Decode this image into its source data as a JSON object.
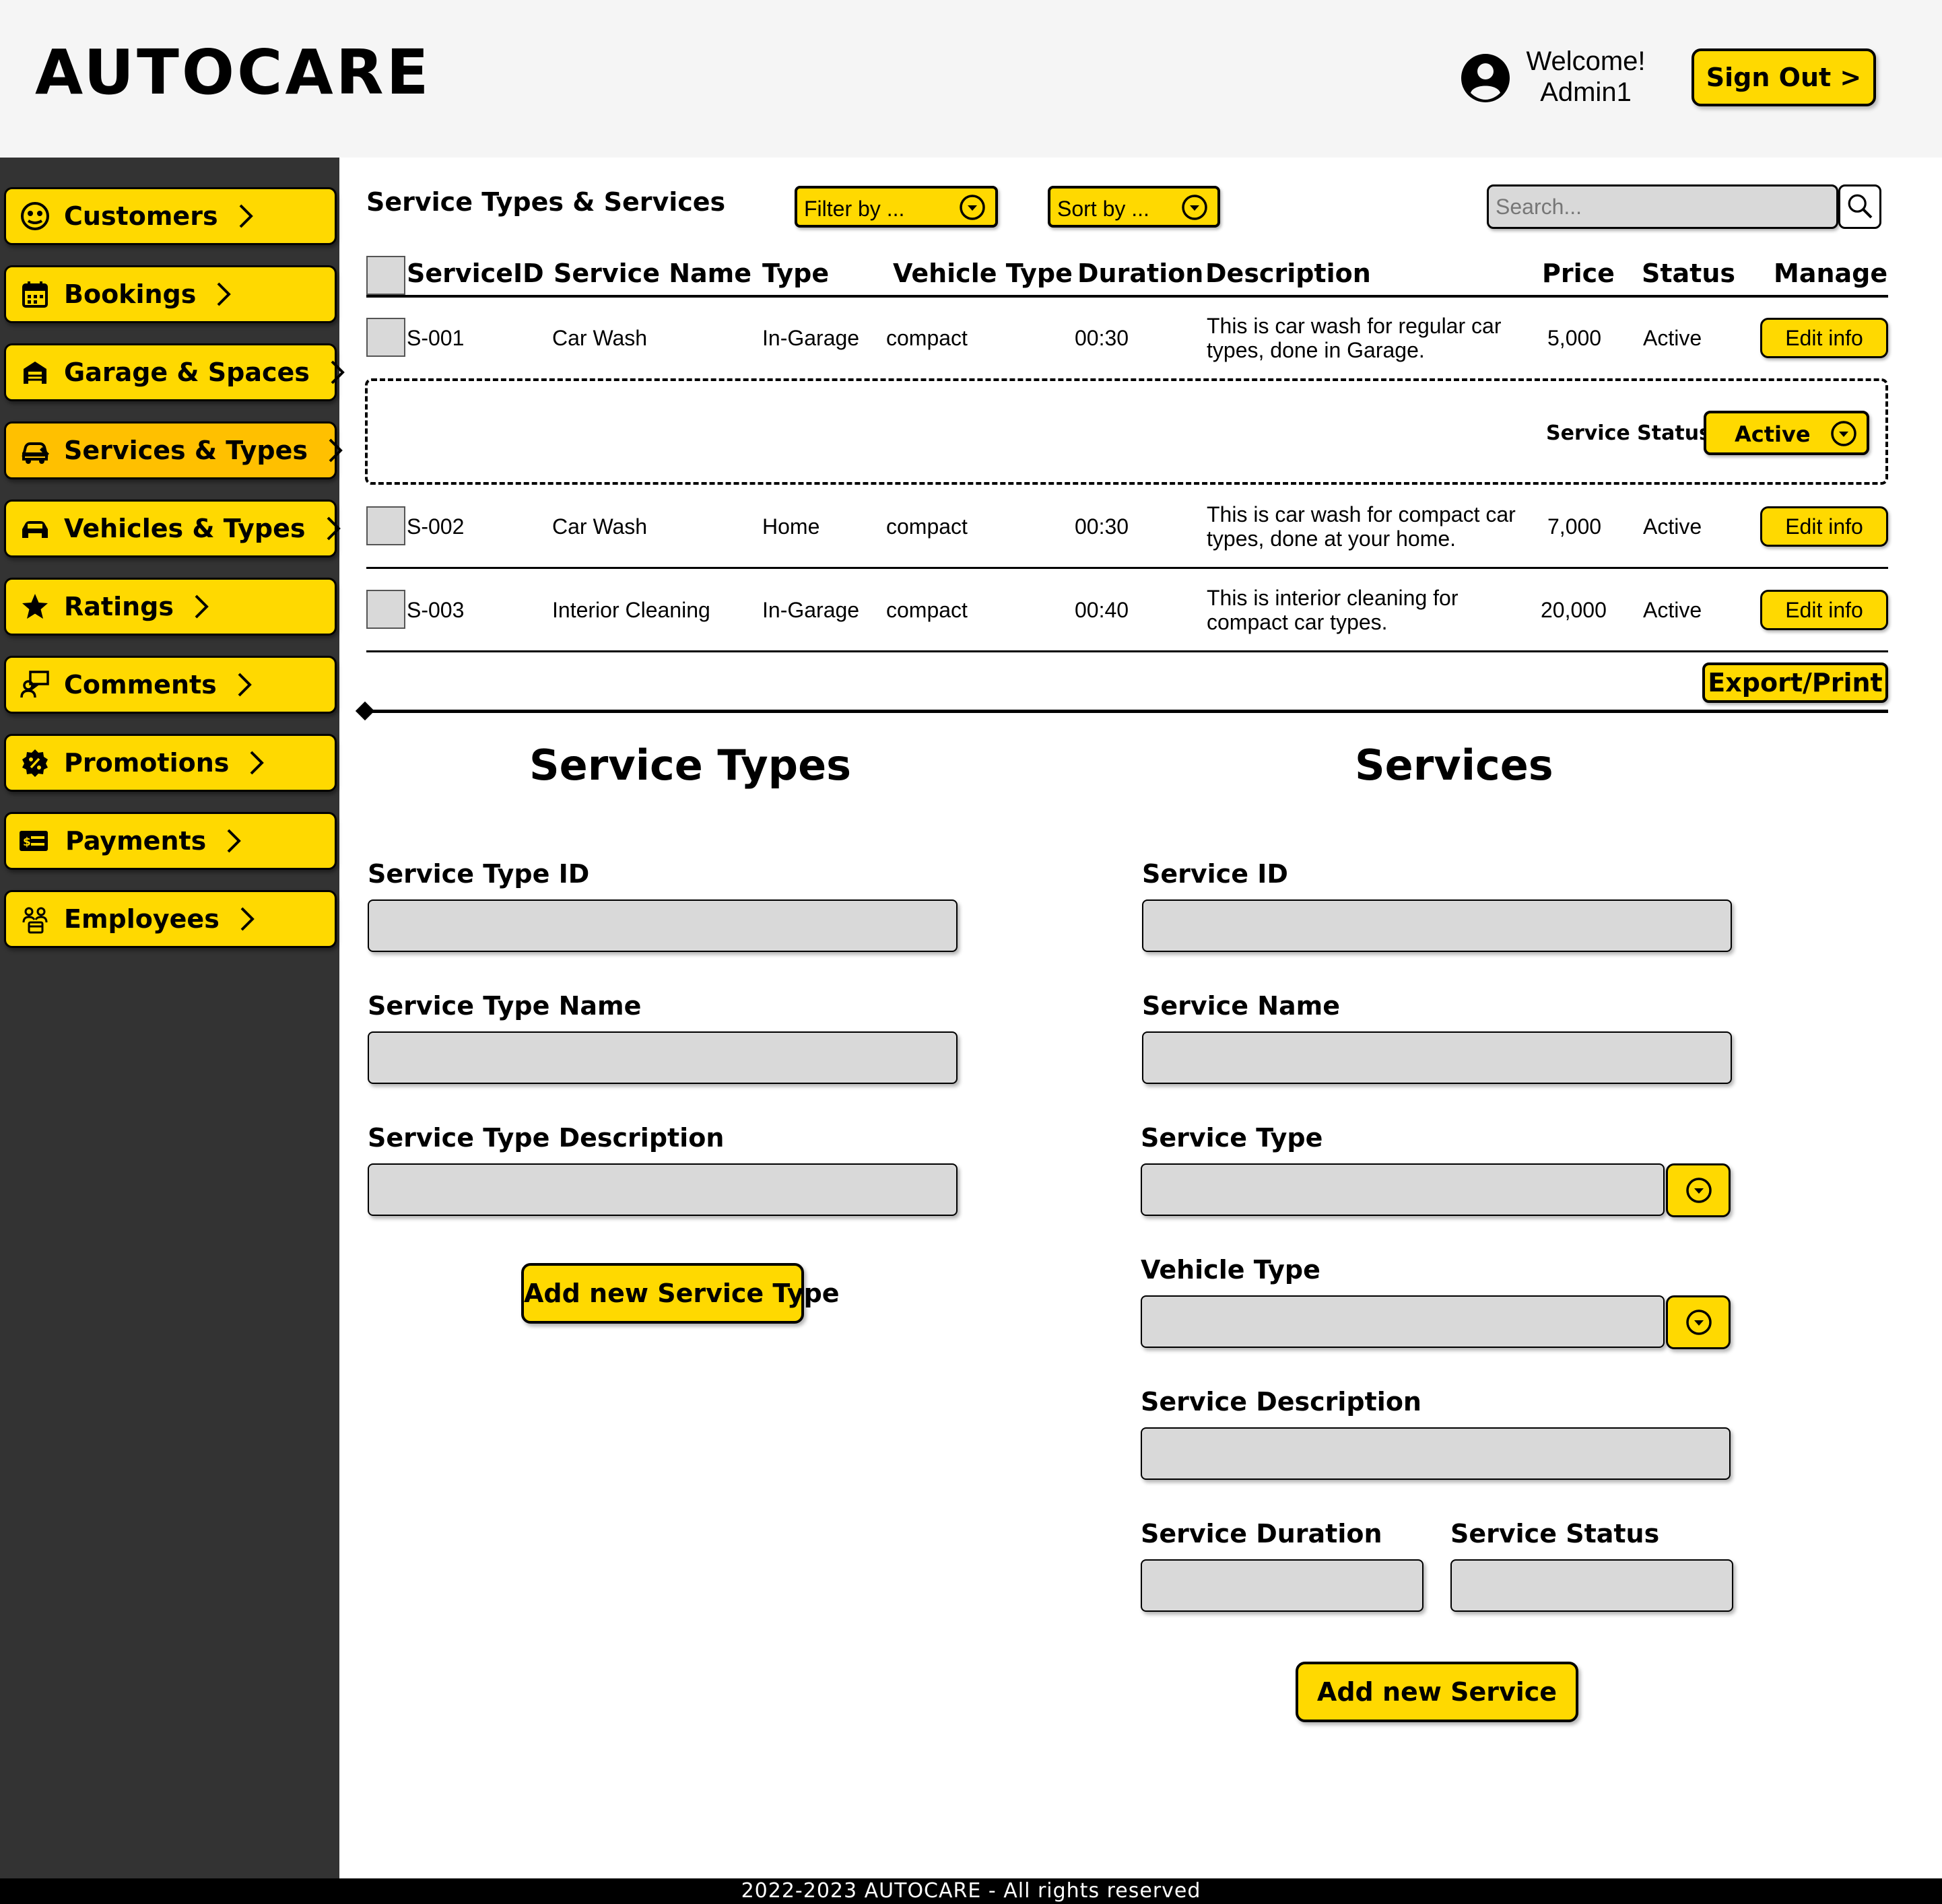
{
  "app": {
    "logo": "AUTOCARE"
  },
  "header": {
    "welcome_line1": "Welcome!",
    "welcome_line2": "Admin1",
    "sign_out_label": "Sign Out >"
  },
  "sidebar": {
    "items": [
      {
        "label": "Customers",
        "icon": "customers-icon"
      },
      {
        "label": "Bookings",
        "icon": "calendar-icon"
      },
      {
        "label": "Garage & Spaces",
        "icon": "garage-icon"
      },
      {
        "label": "Services & Types",
        "icon": "car-service-icon",
        "active": true
      },
      {
        "label": "Vehicles & Types",
        "icon": "car-icon"
      },
      {
        "label": "Ratings",
        "icon": "star-icon"
      },
      {
        "label": "Comments",
        "icon": "comment-user-icon"
      },
      {
        "label": "Promotions",
        "icon": "promotion-badge-icon"
      },
      {
        "label": "Payments",
        "icon": "payment-card-icon"
      },
      {
        "label": "Employees",
        "icon": "employees-icon"
      }
    ]
  },
  "toolbar": {
    "title": "Service Types & Services",
    "filter_label": "Filter by ...",
    "sort_label": "Sort by ...",
    "search_placeholder": "Search..."
  },
  "table": {
    "columns": [
      "ServiceID",
      "Service Name",
      "Type",
      "Vehicle Type",
      "Duration",
      "Description",
      "Price",
      "Status",
      "Manage"
    ],
    "rows": [
      {
        "id": "S-001",
        "name": "Car Wash",
        "type": "In-Garage",
        "vehicle_type": "compact",
        "duration": "00:30",
        "description": "This is car wash for regular car types, done in Garage.",
        "price": "5,000",
        "status": "Active",
        "manage": "Edit info"
      },
      {
        "id": "S-002",
        "name": "Car Wash",
        "type": "Home",
        "vehicle_type": "compact",
        "duration": "00:30",
        "description": "This is car wash for compact car types, done at your home.",
        "price": "7,000",
        "status": "Active",
        "manage": "Edit info"
      },
      {
        "id": "S-003",
        "name": "Interior Cleaning",
        "type": "In-Garage",
        "vehicle_type": "compact",
        "duration": "00:40",
        "description": "This is interior cleaning for compact car types.",
        "price": "20,000",
        "status": "Active",
        "manage": "Edit info"
      }
    ],
    "expanded": {
      "label": "Service Status:",
      "value": "Active"
    },
    "export_label": "Export/Print"
  },
  "service_types_form": {
    "title": "Service Types",
    "id_label": "Service Type ID",
    "name_label": "Service Type Name",
    "description_label": "Service Type Description",
    "submit_label": "Add new Service Type"
  },
  "services_form": {
    "title": "Services",
    "id_label": "Service ID",
    "name_label": "Service Name",
    "type_label": "Service Type",
    "vehicle_type_label": "Vehicle Type",
    "description_label": "Service Description",
    "duration_label": "Service Duration",
    "status_label": "Service Status",
    "submit_label": "Add new Service"
  },
  "footer": {
    "text": "2022-2023 AUTOCARE - All rights reserved"
  },
  "colors": {
    "accent": "#FFD900",
    "accent_active": "#FFC000",
    "sidebar": "#333333",
    "field": "#D9D9D9"
  }
}
